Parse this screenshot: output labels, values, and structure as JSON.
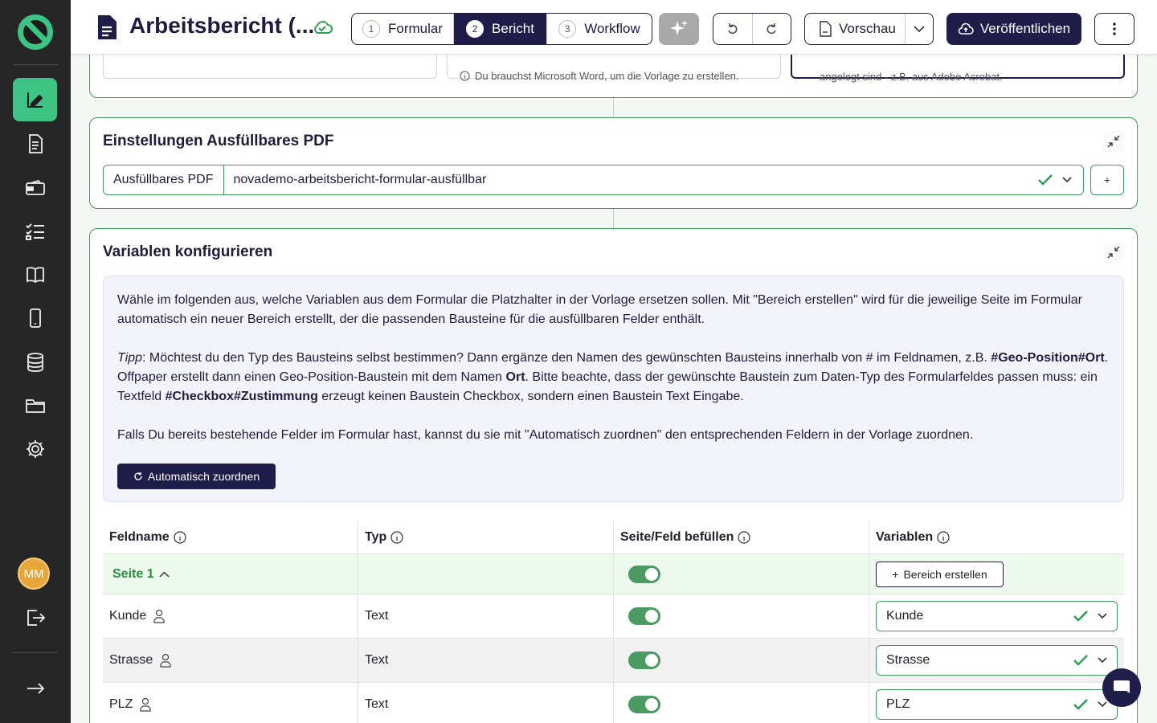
{
  "header": {
    "title": "Arbeitsbericht (...",
    "steps": [
      {
        "num": "1",
        "label": "Formular"
      },
      {
        "num": "2",
        "label": "Bericht"
      },
      {
        "num": "3",
        "label": "Workflow"
      }
    ],
    "preview_label": "Vorschau",
    "publish_label": "Veröffentlichen"
  },
  "top_card": {
    "word_hint": "Du brauchst Microsoft Word, um die Vorlage zu erstellen.",
    "pdf_hint": "angelegt sind - z.B. aus Adobe Acrobat."
  },
  "pdf_settings": {
    "title": "Einstellungen Ausfüllbares PDF",
    "field_label": "Ausfüllbares PDF",
    "field_value": "novademo-arbeitsbericht-formular-ausfüllbar",
    "add_label": "+"
  },
  "variables": {
    "title": "Variablen konfigurieren",
    "intro": "Wähle im folgenden aus, welche Variablen aus dem Formular die Platzhalter in der Vorlage ersetzen sollen. Mit \"Bereich erstellen\" wird für die jeweilige Seite im Formular automatisch ein neuer Bereich erstellt, der die passenden Bausteine für die ausfüllbaren Felder enthält.",
    "tip_label": "Tipp",
    "tip_1": ": Möchtest du den Typ des Bausteins selbst bestimmen? Dann ergänze den Namen des gewünschten Bausteins innerhalb von # im Feldnamen, z.B. ",
    "tip_example_1": "#Geo-Position#Ort",
    "tip_2": ". Offpaper erstellt dann einen Geo-Position-Baustein mit dem Namen ",
    "tip_name": "Ort",
    "tip_3": ". Bitte beachte, dass der gewünschte Baustein zum Daten-Typ des Formularfeldes passen muss: ein Textfeld ",
    "tip_example_2": "#Checkbox#Zustimmung",
    "tip_4": " erzeugt keinen Baustein Checkbox, sondern einen Baustein Text Eingabe.",
    "existing": "Falls Du bereits bestehende Felder im Formular hast, kannst du sie mit \"Automatisch zuordnen\" den entsprechenden Feldern in der Vorlage zuordnen.",
    "auto_button": "Automatisch zuordnen",
    "columns": [
      "Feldname",
      "Typ",
      "Seite/Feld befüllen",
      "Variablen"
    ],
    "section_label": "Seite 1",
    "bereich_button": "Bereich erstellen",
    "rows": [
      {
        "name": "Kunde",
        "type": "Text",
        "variable": "Kunde"
      },
      {
        "name": "Strasse",
        "type": "Text",
        "variable": "Strasse"
      },
      {
        "name": "PLZ",
        "type": "Text",
        "variable": "PLZ"
      }
    ]
  },
  "sidebar": {
    "avatar_initials": "MM",
    "items": [
      "report-editor",
      "documents",
      "inbox",
      "checklists",
      "manual",
      "mobile",
      "database",
      "folders",
      "settings"
    ]
  },
  "colors": {
    "brand_dark": "#1f1d4a",
    "accent_green": "#3dc484",
    "border_green": "#3f9c5f",
    "sidebar_bg": "#262626"
  }
}
